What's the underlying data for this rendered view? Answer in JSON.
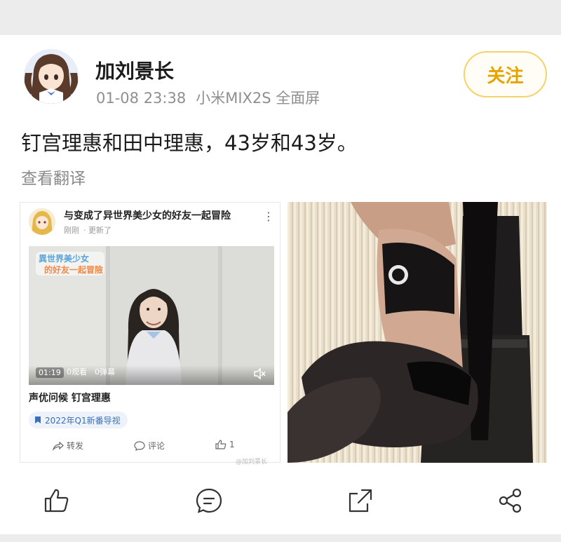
{
  "post": {
    "username": "加刘景长",
    "date": "01-08 23:38",
    "device": "小米MIX2S 全面屏",
    "follow_label": "关注",
    "text": "钉宫理惠和田中理惠，43岁和43岁。",
    "translate_label": "查看翻译"
  },
  "embed": {
    "title": "与变成了异世界美少女的好友一起冒险",
    "time_ago": "刚刚",
    "updated": "· 更新了",
    "video_title_art": "異世界美少女的好友一起冒險",
    "duration": "01:19",
    "views": "0观看",
    "danmaku": "0弹幕",
    "caption": "声优问候 钉宫理惠",
    "tag": "2022年Q1新番导视",
    "repost_label": "转发",
    "comment_label": "评论",
    "like_count": "1",
    "watermark": "@加刘景长"
  },
  "icons": {
    "like": "thumbs-up-icon",
    "comment": "comment-icon",
    "share": "share-external-icon",
    "more_share": "share-nodes-icon"
  },
  "colors": {
    "accent": "#e6a400",
    "accent_border": "#f5d36a",
    "meta_gray": "#8f8f8f",
    "tag_blue": "#3b6fb6"
  }
}
